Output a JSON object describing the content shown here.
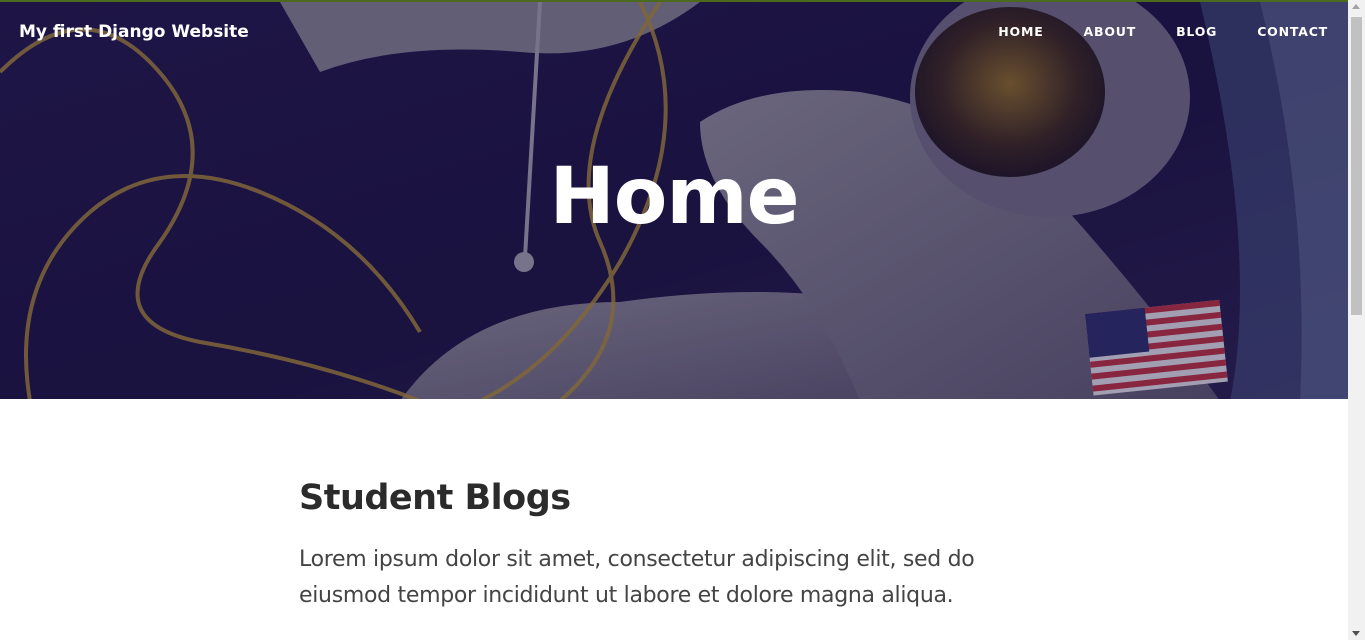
{
  "header": {
    "brand": "My first Django Website",
    "nav": [
      "HOME",
      "ABOUT",
      "BLOG",
      "CONTACT"
    ]
  },
  "hero": {
    "title": "Home",
    "background_image": "astronaut-spacewalk-image"
  },
  "main": {
    "heading": "Student Blogs",
    "paragraph": "Lorem ipsum dolor sit amet, consectetur adipiscing elit, sed do eiusmod tempor incididunt ut labore et dolore magna aliqua."
  },
  "colors": {
    "hero_bg": "#1f1740",
    "heading_text": "#2b2b2b",
    "body_text": "#444444"
  }
}
